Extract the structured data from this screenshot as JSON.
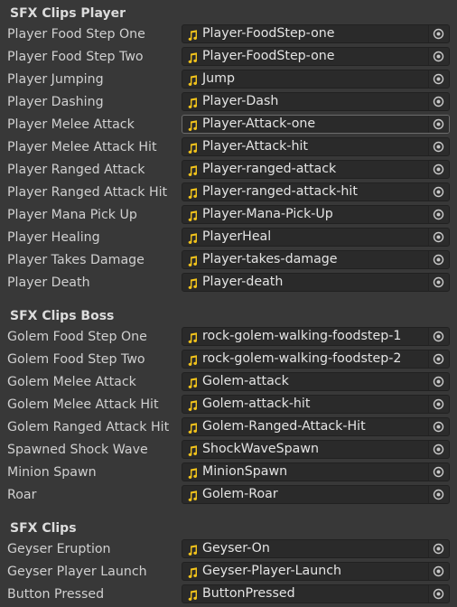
{
  "colors": {
    "background": "#383838",
    "field_background": "#2a2a2a",
    "clip_icon": "#f2c31b",
    "text": "#d0d0d0"
  },
  "icons": {
    "clip": "audio-clip-icon",
    "picker": "object-picker-icon"
  },
  "sections": [
    {
      "header": "SFX Clips Player",
      "rows": [
        {
          "label": "Player Food Step One",
          "value": "Player-FoodStep-one"
        },
        {
          "label": "Player Food Step Two",
          "value": "Player-FoodStep-one"
        },
        {
          "label": "Player Jumping",
          "value": "Jump"
        },
        {
          "label": "Player Dashing",
          "value": "Player-Dash"
        },
        {
          "label": "Player Melee Attack",
          "value": "Player-Attack-one"
        },
        {
          "label": "Player Melee Attack Hit",
          "value": "Player-Attack-hit"
        },
        {
          "label": "Player Ranged Attack",
          "value": "Player-ranged-attack"
        },
        {
          "label": "Player Ranged Attack Hit",
          "value": "Player-ranged-attack-hit"
        },
        {
          "label": "Player Mana Pick Up",
          "value": "Player-Mana-Pick-Up"
        },
        {
          "label": "Player Healing",
          "value": "PlayerHeal"
        },
        {
          "label": "Player Takes Damage",
          "value": "Player-takes-damage"
        },
        {
          "label": "Player Death",
          "value": "Player-death"
        }
      ]
    },
    {
      "header": "SFX Clips Boss",
      "rows": [
        {
          "label": "Golem Food Step One",
          "value": "rock-golem-walking-foodstep-1"
        },
        {
          "label": "Golem Food Step Two",
          "value": "rock-golem-walking-foodstep-2"
        },
        {
          "label": "Golem Melee Attack",
          "value": "Golem-attack"
        },
        {
          "label": "Golem Melee Attack Hit",
          "value": "Golem-attack-hit"
        },
        {
          "label": "Golem Ranged Attack Hit",
          "value": "Golem-Ranged-Attack-Hit"
        },
        {
          "label": "Spawned Shock Wave",
          "value": "ShockWaveSpawn"
        },
        {
          "label": "Minion Spawn",
          "value": "MinionSpawn"
        },
        {
          "label": "Roar",
          "value": "Golem-Roar"
        }
      ]
    },
    {
      "header": "SFX Clips",
      "rows": [
        {
          "label": "Geyser Eruption",
          "value": "Geyser-On"
        },
        {
          "label": "Geyser Player Launch",
          "value": "Geyser-Player-Launch"
        },
        {
          "label": "Button Pressed",
          "value": "ButtonPressed"
        }
      ]
    }
  ]
}
